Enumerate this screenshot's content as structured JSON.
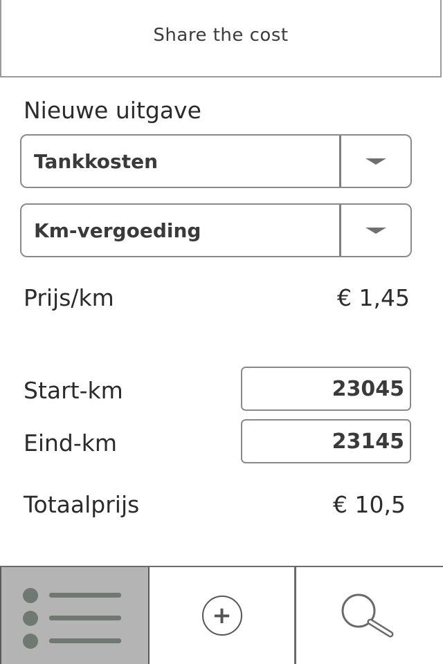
{
  "header": {
    "title": "Share the cost"
  },
  "form": {
    "title": "Nieuwe uitgave",
    "category_select": {
      "value": "Tankkosten"
    },
    "type_select": {
      "value": "Km-vergoeding"
    },
    "price_per_km": {
      "label": "Prijs/km",
      "value": "€ 1,45"
    },
    "start_km": {
      "label": "Start-km",
      "value": "23045"
    },
    "end_km": {
      "label": "Eind-km",
      "value": "23145"
    },
    "total": {
      "label": "Totaalprijs",
      "value": "€ 10,5"
    }
  },
  "tabbar": {
    "tabs": [
      {
        "icon": "list-icon",
        "active": true
      },
      {
        "icon": "add-icon",
        "active": false
      },
      {
        "icon": "search-icon",
        "active": false
      }
    ],
    "add_symbol": "+"
  }
}
